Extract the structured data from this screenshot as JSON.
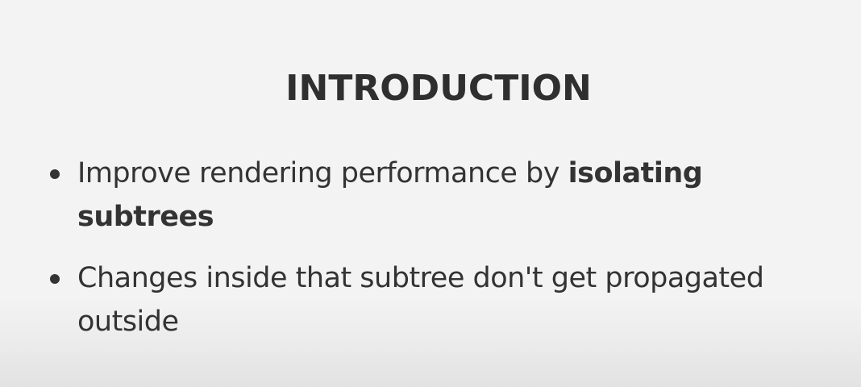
{
  "slide": {
    "title": "INTRODUCTION",
    "bullets": [
      {
        "text": "Improve rendering performance by ",
        "bold": "isolating subtrees"
      },
      {
        "text": "Changes inside that subtree don't get propagated outside"
      }
    ]
  }
}
